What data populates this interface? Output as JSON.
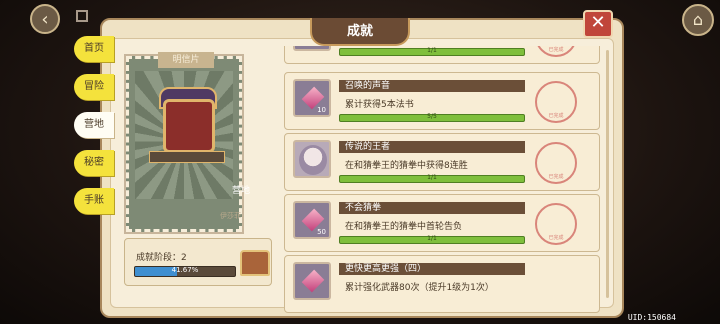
{
  "panel": {
    "title": "成就"
  },
  "tabs": [
    "首页",
    "冒险",
    "营地",
    "秘密",
    "手账"
  ],
  "postcard": {
    "header": "明信片",
    "label": "营地",
    "signature": "伊莎菲"
  },
  "stage": {
    "label": "成就阶段：2",
    "progress_text": "41.67%",
    "progress": 0.4167
  },
  "achievements": [
    {
      "title": "",
      "desc": "",
      "progress": "1/1",
      "count": "",
      "icon": "gem-icon"
    },
    {
      "title": "召唤的声音",
      "desc": "累计获得5本法书",
      "progress": "5/5",
      "count": "10",
      "icon": "gem-icon"
    },
    {
      "title": "传说的王者",
      "desc": "在和猜拳王的猜拳中获得8连胜",
      "progress": "1/1",
      "count": "",
      "icon": "avatar-icon"
    },
    {
      "title": "不会猜拳",
      "desc": "在和猜拳王的猜拳中首轮告负",
      "progress": "1/1",
      "count": "50",
      "icon": "gem-icon"
    },
    {
      "title": "更快更高更强（四）",
      "desc": "累计强化武器80次（提升1级为1次）",
      "progress": "",
      "count": "",
      "icon": "gem-icon"
    }
  ],
  "seal_text": "已完成",
  "uid": "UID:150684",
  "colors": {
    "accent": "#6b4f38",
    "progress_green": "#7fbf3c",
    "progress_blue": "#3f8fd0",
    "tab_yellow": "#f4e23c",
    "close_red": "#c0463a"
  }
}
